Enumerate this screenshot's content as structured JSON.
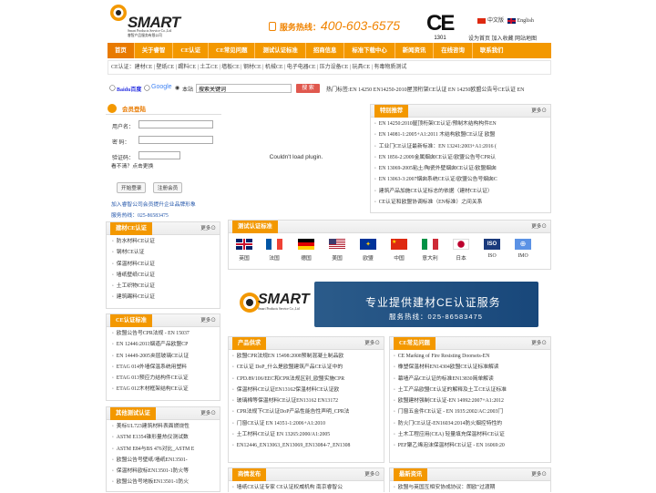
{
  "header": {
    "brand": "SMART",
    "brand_sub1": "Smart Products Service Co.,Ltd",
    "brand_sub2": "睿智产品服务有限公司",
    "hotline_label": "服务热线：",
    "hotline_number": "400-603-6575",
    "ce_mark": "CE",
    "ce_number": "1301",
    "lang_cn": "中文版",
    "lang_en": "English",
    "toplinks": "设为首页  加入收藏  网站地图"
  },
  "nav": [
    "首页",
    "关于睿智",
    "CE认证",
    "CE常见问题",
    "测试认证标准",
    "招商信息",
    "标准下载中心",
    "新闻资讯",
    "在线咨询",
    "联系我们"
  ],
  "subnav": "CE认证：建材CE | 壁纸CE | 踢料CE | 土工CE | 墙板CE | 钢材CE | 机械CE | 电子电器CE | 压力设备CE | 玩具CE | 有毒物质测试",
  "search": {
    "baidu": "Baidu百度",
    "google": "Google",
    "site": "本站",
    "placeholder": "搜索关键词",
    "button": "搜 索",
    "hot": "热门标签:EN 14250 EN14250-2010屋顶桁架CE认证 EN 14250欧盟公告号CE认证 EN"
  },
  "login": {
    "title": "会员登陆",
    "username": "用户名：",
    "password": "密  码：",
    "captcha": "验证码：",
    "refresh": "看不清？点击更换",
    "login_btn": "开始登录",
    "register_btn": "注册会员",
    "join": "加入睿智公司会员提升企业品牌形象",
    "service": "服务热线：025-86583475"
  },
  "plugin_msg": "Couldn't load plugin.",
  "special": {
    "title": "特别推荐",
    "more": "更多⊙",
    "items": [
      "EN 14250:2010屋顶桁架CE认证/预制木结构构件EN",
      "EN 14081-1:2005+A1:2011 木结构欧盟CE认证 欧盟",
      "工业门CE认证最新标准：EN 13241:2003+A1:2016 (",
      "EN 1856-2:2009金属烟囱CE认证/欧盟公告号CPR认",
      "EN 13069-2005粘土/陶瓷外壁烟囱CE认证/欧盟烟囱",
      "EN 13063-3:2007烟囱系统CE认证/欧盟公告号烟囱C",
      "建筑产品加施CE认证标志的依据（建材CE认证）",
      "CE认证和欧盟协调标准（EN标准）之间关系"
    ]
  },
  "materials": {
    "title": "建材CE认证",
    "more": "更多⊙",
    "items": [
      "防水材料CE认证",
      "钢材CE认证",
      "保温材料CE认证",
      "墙纸壁纸CE认证",
      "土工织物CE认证",
      "建筑踢料CE认证"
    ]
  },
  "cert_news": {
    "title": "CE认证标准",
    "more": "更多⊙",
    "items": [
      "欧盟公告号CPR法规 - EN 15037",
      "EN 12446:2011烟道产品欧盟CP",
      "EN 14449-2005夹层玻璃CE认证",
      "ETAG 014外墙保温系统用塑料",
      "ETAG 013预应力结构件CE认证",
      "ETAG 012木材框架结构CE认证"
    ]
  },
  "other": {
    "title": "其他测试认证",
    "more": "更多⊙",
    "items": [
      "美标UL723建筑材料表面燃烧性",
      "ASTM E1354锥形量热仪测试数",
      "ASTM E84与BS 476对比_ASTM E",
      "欧盟公告号壁纸/墙纸EN13501-",
      "保温材料欧标EN13501-1防火等",
      "欧盟公告号地板EN13501-1防火"
    ]
  },
  "standards": {
    "title": "测试认证标准",
    "more": "更多⊙",
    "flags": [
      "英国",
      "法国",
      "德国",
      "美国",
      "欧盟",
      "中国",
      "意大利",
      "日本",
      "ISO",
      "IMO"
    ]
  },
  "banner": {
    "line1": "专业提供建材CE认证服务",
    "line2": "服务热线：025-86583475"
  },
  "products": {
    "title": "产品供求",
    "more": "更多⊙",
    "items": [
      "欧盟CPR法规EN 15498:2008预制混凝土制品欧",
      "CE认证 DoP_什么是欧盟建筑产品CE认证中的",
      "CPD.89/106/EEC和CPR法规区别_欧盟实施CPR",
      "保温材料CE认证EN13162保温材料CE认证欧",
      "玻璃棉等保温材料CE认证EN13162 EN13172",
      "CPR法规下CE认证DoP产品性能告性声明_CPR法",
      "门窗CE认证 EN 14351-1:2006+A1:2010",
      "土工材料CE认证 EN 13265:2000/A1:2005",
      "EN12446_EN13063_EN13069_EN13084-7_EN1308"
    ]
  },
  "faq": {
    "title": "CE常见问题",
    "more": "更多⊙",
    "items": [
      "CE Marking of Fire Resisting Doorsets-EN",
      "橡塑保温材料EN14304欧盟CE认证标准解读",
      "幕墙产品CE认证的标准EN13830简单解读",
      "土工产品欧盟CE认证的解释及土工CE认证标准",
      "欧盟建材强制CE认证-EN 14992:2007+A1:2012",
      "门窗五金件CE认证 - EN 1935:2002/AC:2003门",
      "防火门CE认证-EN16034:2014防火烟控特性的",
      "土木工程应用(CEA) 轻量填充保温材料CE认证",
      "PEF聚乙烯泡沫保温材料CE认证 - EN 16069:20"
    ]
  },
  "merchants": {
    "title": "商情发布",
    "more": "更多⊙",
    "items": [
      "墙纸CE认证专家 CE认证权威机构 南京睿智公"
    ]
  },
  "news": {
    "title": "最新资讯",
    "more": "更多⊙",
    "items": [
      "欧盟与英国互相安协成协议：朗欧\"过渡期"
    ]
  }
}
